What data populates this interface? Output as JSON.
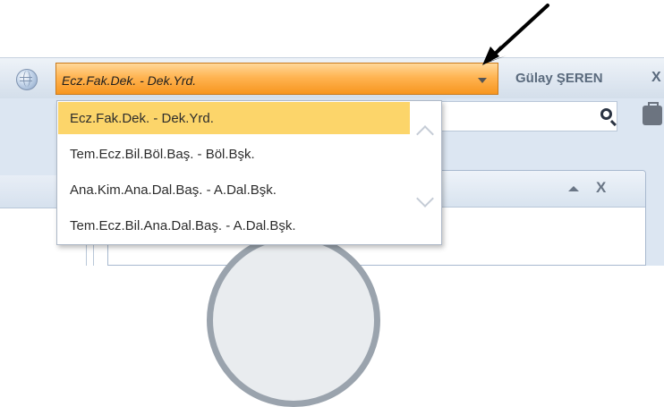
{
  "header": {
    "role_select": {
      "selected_value": "Ecz.Fak.Dek. - Dek.Yrd.",
      "options": [
        "Ecz.Fak.Dek. - Dek.Yrd.",
        "Tem.Ecz.Bil.Böl.Baş. - Böl.Bşk.",
        "Ana.Kim.Ana.Dal.Baş. - A.Dal.Bşk.",
        "Tem.Ecz.Bil.Ana.Dal.Baş. - A.Dal.Bşk."
      ]
    },
    "user_name": "Gülay ŞEREN",
    "close_label": "X"
  },
  "panel": {
    "close_label": "X"
  },
  "icons": {
    "globe": "globe-icon",
    "search": "search-icon",
    "briefcase": "briefcase-icon",
    "dropdown_caret": "chevron-down-icon",
    "scroll_up": "chevron-up-icon",
    "scroll_down": "chevron-down-icon",
    "panel_collapse": "triangle-up-icon"
  },
  "colors": {
    "select_accent": "#f7961f",
    "selected_option": "#fcd56a",
    "toolbar_bg": "#dce6f2"
  }
}
